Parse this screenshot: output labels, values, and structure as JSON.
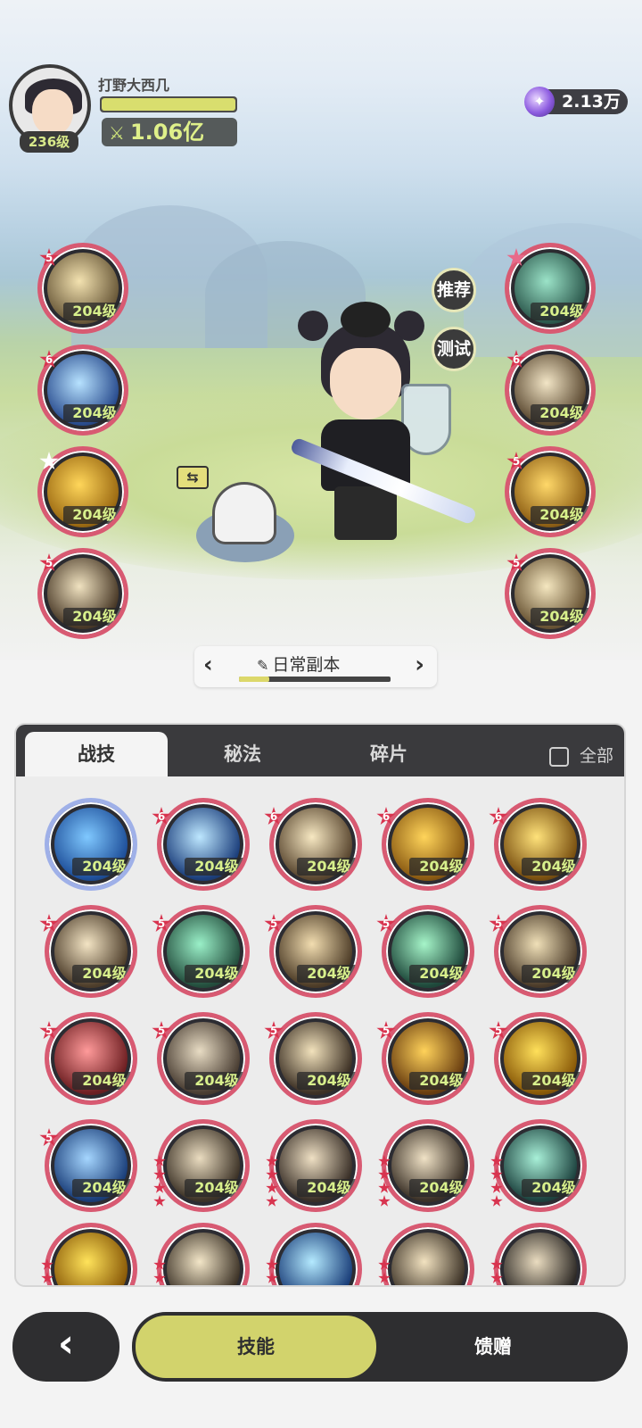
{
  "player": {
    "name": "打野大西几",
    "level_label": "236级",
    "exp_fraction": 1.0,
    "power_label": "1.06亿"
  },
  "currency": {
    "amount": "2.13万",
    "icon": "purple-gem-icon"
  },
  "equipped": {
    "left": [
      {
        "level": "204级",
        "stars": "5",
        "star_style": "red",
        "colors": [
          "#f3e2b0",
          "#6b5a3a"
        ]
      },
      {
        "level": "204级",
        "stars": "6",
        "star_style": "red",
        "colors": [
          "#b7e2ff",
          "#2a4d8f"
        ]
      },
      {
        "level": "204级",
        "stars": "",
        "star_style": "white",
        "colors": [
          "#ffd65a",
          "#9c6a12"
        ]
      },
      {
        "level": "204级",
        "stars": "5",
        "star_style": "red",
        "colors": [
          "#f0e2c0",
          "#4a3a28"
        ]
      }
    ],
    "right": [
      {
        "level": "204级",
        "stars": "",
        "star_style": "pink",
        "colors": [
          "#9be3c8",
          "#2d5a4e"
        ]
      },
      {
        "level": "204级",
        "stars": "6",
        "star_style": "red",
        "colors": [
          "#f2e5c6",
          "#5c4a32"
        ]
      },
      {
        "level": "204级",
        "stars": "5",
        "star_style": "red",
        "colors": [
          "#ffd869",
          "#8f6015"
        ]
      },
      {
        "level": "204级",
        "stars": "5",
        "star_style": "red",
        "colors": [
          "#f5e7c0",
          "#6a5535"
        ]
      }
    ]
  },
  "side_buttons": {
    "recommend": "推荐",
    "test": "测试"
  },
  "pet_tag": "⇆",
  "dungeon": {
    "title": "日常副本",
    "progress_fraction": 0.2
  },
  "panel": {
    "tabs": [
      "战技",
      "秘法",
      "碎片"
    ],
    "active_tab": 0,
    "all_label": "全部",
    "skills": [
      {
        "level": "204级",
        "stars": "",
        "stack": 0,
        "rainbow": true,
        "colors": [
          "#7fc8ff",
          "#1e4f9a"
        ]
      },
      {
        "level": "204级",
        "stars": "6",
        "stack": 0,
        "colors": [
          "#bde7ff",
          "#1c3f7c"
        ]
      },
      {
        "level": "204级",
        "stars": "6",
        "stack": 0,
        "colors": [
          "#f7e8c2",
          "#5a4730"
        ]
      },
      {
        "level": "204级",
        "stars": "6",
        "stack": 0,
        "colors": [
          "#ffd45a",
          "#8a5a12"
        ]
      },
      {
        "level": "204级",
        "stars": "6",
        "stack": 0,
        "colors": [
          "#ffe27a",
          "#7a5010"
        ]
      },
      {
        "level": "204级",
        "stars": "5",
        "stack": 0,
        "colors": [
          "#f3e4c4",
          "#4f3f2c"
        ]
      },
      {
        "level": "204级",
        "stars": "5",
        "stack": 0,
        "colors": [
          "#9af0c8",
          "#244f3e"
        ]
      },
      {
        "level": "204级",
        "stars": "5",
        "stack": 0,
        "colors": [
          "#f2ddb0",
          "#4e3d28"
        ]
      },
      {
        "level": "204级",
        "stars": "5",
        "stack": 0,
        "colors": [
          "#a6f5c9",
          "#1f4a3c"
        ]
      },
      {
        "level": "204级",
        "stars": "5",
        "stack": 0,
        "colors": [
          "#f0e0b8",
          "#4c3c2a"
        ]
      },
      {
        "level": "204级",
        "stars": "5",
        "stack": 0,
        "colors": [
          "#ff9a9a",
          "#6e1f22"
        ]
      },
      {
        "level": "204级",
        "stars": "5",
        "stack": 0,
        "colors": [
          "#e8dcc4",
          "#4a3e33"
        ]
      },
      {
        "level": "204级",
        "stars": "5",
        "stack": 0,
        "colors": [
          "#f2e2bc",
          "#3e3226"
        ]
      },
      {
        "level": "204级",
        "stars": "5",
        "stack": 0,
        "colors": [
          "#ffd25a",
          "#6a3e10"
        ]
      },
      {
        "level": "204级",
        "stars": "5",
        "stack": 0,
        "colors": [
          "#ffe05a",
          "#8a5a08"
        ]
      },
      {
        "level": "204级",
        "stars": "5",
        "stack": 0,
        "colors": [
          "#a5d6ff",
          "#1b3f7a"
        ]
      },
      {
        "level": "204级",
        "stars": "",
        "stack": 4,
        "colors": [
          "#eadcc0",
          "#3e3428"
        ]
      },
      {
        "level": "204级",
        "stars": "",
        "stack": 4,
        "colors": [
          "#efe0c4",
          "#3a3028"
        ]
      },
      {
        "level": "204级",
        "stars": "",
        "stack": 4,
        "colors": [
          "#f0e2c6",
          "#3c3228"
        ]
      },
      {
        "level": "204级",
        "stars": "",
        "stack": 4,
        "colors": [
          "#a8f0d8",
          "#1e4440"
        ]
      },
      {
        "level": "",
        "stars": "",
        "stack": 4,
        "colors": [
          "#ffe35a",
          "#8a5a08"
        ]
      },
      {
        "level": "",
        "stars": "",
        "stack": 4,
        "colors": [
          "#f3e6c8",
          "#3e3428"
        ]
      },
      {
        "level": "",
        "stars": "",
        "stack": 4,
        "colors": [
          "#b4eaff",
          "#1b3f7a"
        ]
      },
      {
        "level": "",
        "stars": "",
        "stack": 4,
        "colors": [
          "#f2e2c0",
          "#3e3428"
        ]
      },
      {
        "level": "",
        "stars": "",
        "stack": 4,
        "colors": [
          "#eadcc0",
          "#2e2a26"
        ]
      }
    ]
  },
  "bottom_nav": {
    "back_icon": "‹",
    "skills": "技能",
    "gift": "馈赠"
  }
}
